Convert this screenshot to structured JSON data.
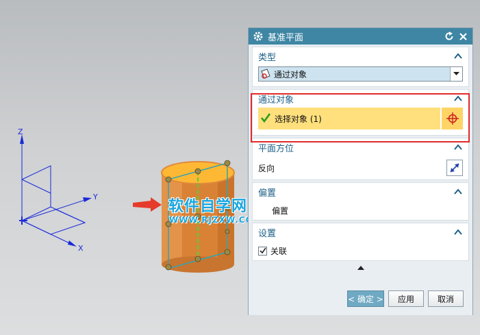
{
  "watermark": {
    "title": "软件自学网",
    "url": "WWW.RJZXW.COM"
  },
  "axes": {
    "x": "X",
    "y": "Y",
    "z": "Z"
  },
  "colors": {
    "titlebar": "#3e86a4",
    "section_header_text": "#1d5f86",
    "selection_bg": "#ffe07d",
    "highlight_border": "#e02a2a",
    "cylinder": "#e08a3c",
    "axis": "#1a2ad8"
  },
  "dialog": {
    "title": "基准平面",
    "icons": {
      "title": "gear-icon",
      "reset": "reset-icon",
      "close": "close-icon"
    },
    "sections": {
      "type": {
        "header": "类型",
        "selected": "通过对象",
        "select_icon": "through-object-icon"
      },
      "through_object": {
        "header": "通过对象",
        "select_label": "选择对象 (1)",
        "check_icon": "check-icon",
        "target_icon": "crosshair-icon"
      },
      "orientation": {
        "header": "平面方位",
        "reverse_label": "反向",
        "reverse_icon": "flip-direction-icon"
      },
      "offset": {
        "header": "偏置",
        "offset_label": "偏置"
      },
      "settings": {
        "header": "设置",
        "associative_label": "关联",
        "associative_checked": true
      }
    },
    "buttons": {
      "ok": "< 确定 >",
      "apply": "应用",
      "cancel": "取消"
    }
  }
}
